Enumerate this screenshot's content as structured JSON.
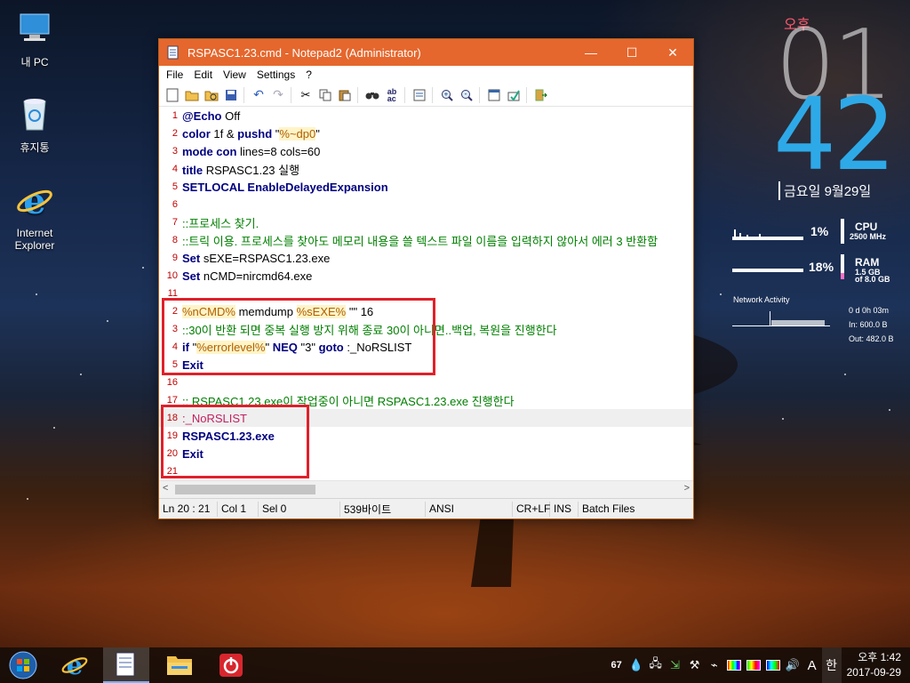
{
  "desktop": {
    "icons": [
      {
        "label": "내 PC"
      },
      {
        "label": "휴지통"
      },
      {
        "label": "Internet Explorer"
      }
    ]
  },
  "window": {
    "title": "RSPASC1.23.cmd - Notepad2 (Administrator)",
    "controls": {
      "minimize": "—",
      "maximize": "☐",
      "close": "✕"
    }
  },
  "menu": {
    "items": [
      "File",
      "Edit",
      "View",
      "Settings",
      "?"
    ]
  },
  "toolbar": {
    "buttons": [
      "new",
      "open",
      "browse",
      "save",
      "undo",
      "redo",
      "cut",
      "copy",
      "paste",
      "find",
      "replace",
      "word-wrap",
      "zoom-in",
      "zoom-out",
      "scheme",
      "customize",
      "exit"
    ]
  },
  "editor": {
    "current_line": 18,
    "lines": [
      {
        "num": "1",
        "parts": [
          {
            "t": "@Echo",
            "c": "kw"
          },
          {
            "t": " Off",
            "c": "plain"
          }
        ]
      },
      {
        "num": "2",
        "parts": [
          {
            "t": "color",
            "c": "kw"
          },
          {
            "t": " 1f & ",
            "c": "plain"
          },
          {
            "t": "pushd",
            "c": "kw"
          },
          {
            "t": " \"",
            "c": "plain"
          },
          {
            "t": "%~dp0",
            "c": "strv"
          },
          {
            "t": "\"",
            "c": "plain"
          }
        ]
      },
      {
        "num": "3",
        "parts": [
          {
            "t": "mode",
            "c": "kw"
          },
          {
            "t": " ",
            "c": "plain"
          },
          {
            "t": "con",
            "c": "kw"
          },
          {
            "t": " lines=8 cols=60",
            "c": "plain"
          }
        ]
      },
      {
        "num": "4",
        "parts": [
          {
            "t": "title",
            "c": "kw"
          },
          {
            "t": " RSPASC1.23 실행",
            "c": "plain"
          }
        ]
      },
      {
        "num": "5",
        "parts": [
          {
            "t": "SETLOCAL EnableDelayedExpansion",
            "c": "kw"
          }
        ]
      },
      {
        "num": "6",
        "parts": []
      },
      {
        "num": "7",
        "parts": [
          {
            "t": "::프로세스 찾기.",
            "c": "com"
          }
        ]
      },
      {
        "num": "8",
        "parts": [
          {
            "t": "::트릭 이용. 프로세스를 찾아도 메모리 내용을 쓸 텍스트 파일 이름을 입력하지 않아서 에러 3 반환함",
            "c": "com"
          }
        ]
      },
      {
        "num": "9",
        "parts": [
          {
            "t": "Set",
            "c": "kw"
          },
          {
            "t": " sEXE=RSPASC1.23.exe",
            "c": "plain"
          }
        ]
      },
      {
        "num": "10",
        "parts": [
          {
            "t": "Set",
            "c": "kw"
          },
          {
            "t": " nCMD=nircmd64.exe",
            "c": "plain"
          }
        ]
      },
      {
        "num": "11",
        "parts": []
      },
      {
        "num": "2",
        "parts": [
          {
            "t": "%nCMD%",
            "c": "var"
          },
          {
            "t": " memdump ",
            "c": "plain"
          },
          {
            "t": "%sEXE%",
            "c": "var"
          },
          {
            "t": " \"\" 16",
            "c": "plain"
          }
        ]
      },
      {
        "num": "3",
        "parts": [
          {
            "t": "::30이 반환 되면 중복 실행 방지 위해 종료 30이 아니면..백업, 복원을 진행한다",
            "c": "com"
          }
        ]
      },
      {
        "num": "4",
        "parts": [
          {
            "t": "if",
            "c": "kw"
          },
          {
            "t": " \"",
            "c": "plain"
          },
          {
            "t": "%errorlevel%",
            "c": "var"
          },
          {
            "t": "\" ",
            "c": "plain"
          },
          {
            "t": "NEQ",
            "c": "kw"
          },
          {
            "t": " \"3\" ",
            "c": "plain"
          },
          {
            "t": "goto",
            "c": "kw"
          },
          {
            "t": " :_NoRSLIST",
            "c": "plain"
          }
        ]
      },
      {
        "num": "5",
        "parts": [
          {
            "t": "Exit",
            "c": "kw"
          }
        ]
      },
      {
        "num": "16",
        "parts": []
      },
      {
        "num": "17",
        "parts": [
          {
            "t": ":: RSPASC1.23.exe이 작업중이 아니면 RSPASC1.23.exe 진행한다",
            "c": "com"
          }
        ]
      },
      {
        "num": "18",
        "parts": [
          {
            "t": ":_NoRSLIST",
            "c": "lbl"
          }
        ]
      },
      {
        "num": "19",
        "parts": [
          {
            "t": "RSPASC1.23.exe",
            "c": "kw"
          }
        ]
      },
      {
        "num": "20",
        "parts": [
          {
            "t": "Exit",
            "c": "kw"
          }
        ]
      },
      {
        "num": "21",
        "parts": []
      }
    ]
  },
  "status": {
    "position": "Ln 20 : 21",
    "col": "Col 1",
    "sel": "Sel 0",
    "size": "539바이트",
    "encoding": "ANSI",
    "eol": "CR+LF",
    "ins": "INS",
    "scheme": "Batch Files"
  },
  "clock_widget": {
    "ampm": "오후",
    "hour": "01",
    "minute": "42",
    "date": "금요일 9월29일"
  },
  "monitor": {
    "cpu_pct": "1%",
    "cpu_label": "CPU",
    "cpu_freq": "2500 MHz",
    "ram_pct": "18%",
    "ram_label": "RAM",
    "ram_used": "1.5 GB",
    "ram_total": "of  8.0 GB",
    "net_title": "Network Activity",
    "net_time": "0 d 0h 03m",
    "net_in": "In: 600.0 B",
    "net_out": "Out: 482.0 B"
  },
  "taskbar": {
    "apps": [
      "start",
      "internet-explorer",
      "notepad2",
      "file-explorer",
      "power-app"
    ],
    "tray_count": "67",
    "ime_lang": "A",
    "ime_mode": "한",
    "time": "오후 1:42",
    "date": "2017-09-29"
  },
  "colors": {
    "titlebar": "#e5672d",
    "highlight_box": "#e0202a",
    "clock_minute": "#2ea9e8",
    "clock_ampm": "#ff5a6e"
  }
}
